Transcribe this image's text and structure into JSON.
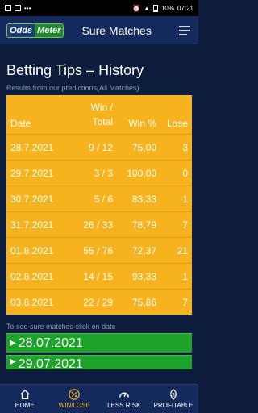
{
  "status": {
    "left_icons": [
      "gallery-icon",
      "photo-icon",
      "more-dots-icon"
    ],
    "battery": "10%",
    "time": "07:21"
  },
  "appbar": {
    "logo_left": "Odds",
    "logo_right": "Meter",
    "title": "Sure Matches"
  },
  "page": {
    "heading": "Betting Tips – History",
    "subheading": "Results from our predictions(All Matches)"
  },
  "table": {
    "headers": {
      "date": "Date",
      "win_total_top": "Win /",
      "win_total_bottom": "Total",
      "win_pct": "Win %",
      "lose": "Lose"
    },
    "rows": [
      {
        "date": "28.7.2021",
        "total": "9 / 12",
        "pct": "75,00",
        "lose": "3"
      },
      {
        "date": "29.7.2021",
        "total": "3 / 3",
        "pct": "100,00",
        "lose": "0"
      },
      {
        "date": "30.7.2021",
        "total": "5 / 6",
        "pct": "83,33",
        "lose": "1"
      },
      {
        "date": "31.7.2021",
        "total": "26 / 33",
        "pct": "78,79",
        "lose": "7"
      },
      {
        "date": "01.8.2021",
        "total": "55 / 76",
        "pct": "72,37",
        "lose": "21"
      },
      {
        "date": "02.8.2021",
        "total": "14 / 15",
        "pct": "93,33",
        "lose": "1"
      },
      {
        "date": "03.8.2021",
        "total": "22 / 29",
        "pct": "75,86",
        "lose": "7"
      }
    ]
  },
  "note": "To see sure matches click on date",
  "date_buttons": [
    "28.07.2021",
    "29.07.2021"
  ],
  "nav": [
    {
      "label": "HOME",
      "icon": "home-icon",
      "active": false
    },
    {
      "label": "WIN/LOSE",
      "icon": "percent-icon",
      "active": true
    },
    {
      "label": "LESS RISK",
      "icon": "speedometer-icon",
      "active": false
    },
    {
      "label": "PROFITABLE",
      "icon": "dollar-icon",
      "active": false
    }
  ],
  "colors": {
    "background": "#0f1d3d",
    "table": "#f7b31d",
    "date_button": "#1ea32a",
    "active_nav": "#f0b21a"
  }
}
